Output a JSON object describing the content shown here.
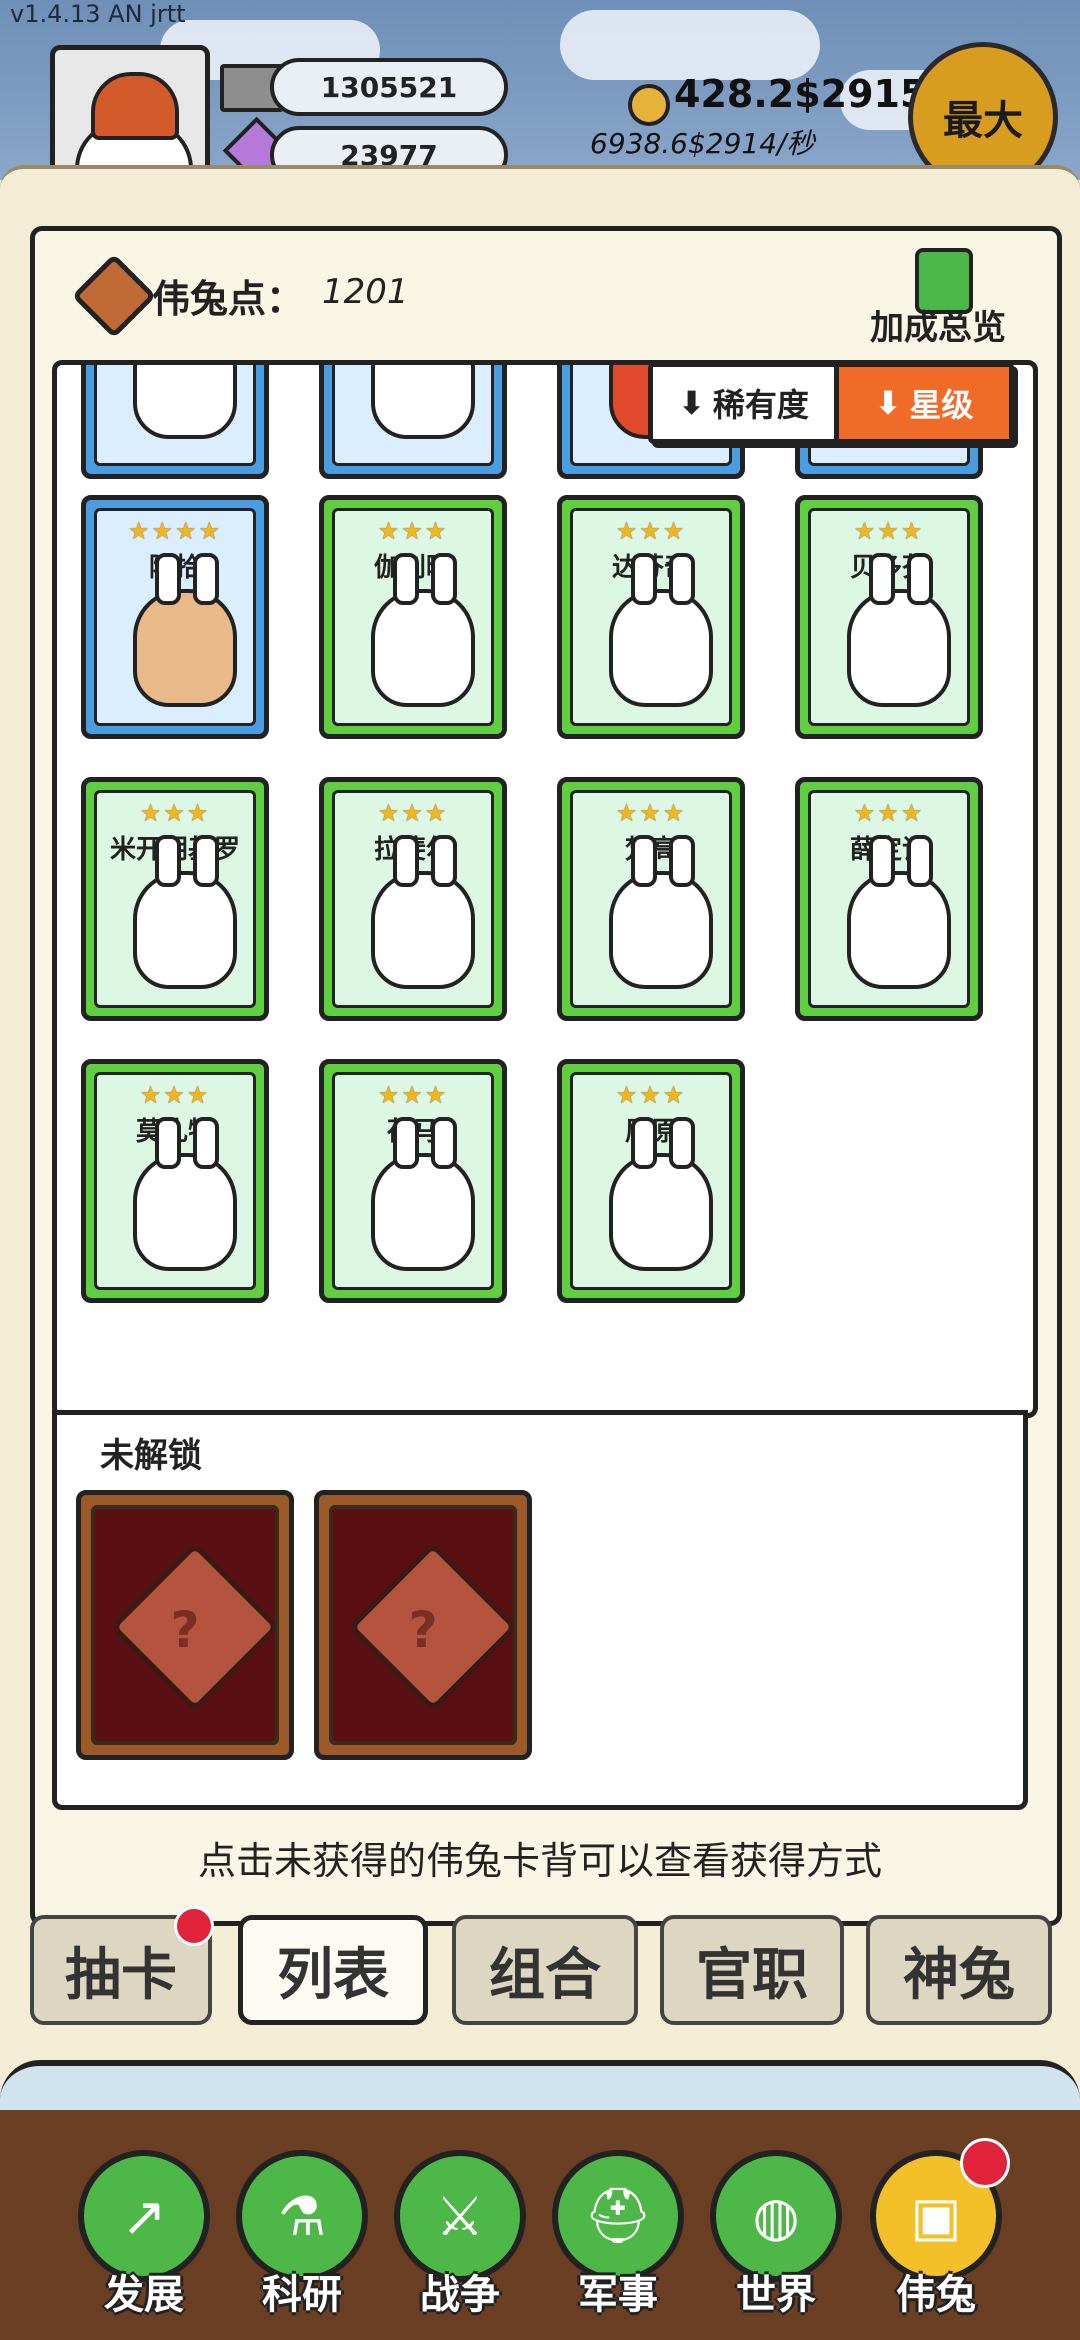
{
  "version": "v1.4.13 AN jrtt",
  "header": {
    "resource_1": "1305521",
    "resource_2": "23977",
    "coin_total": "428.2$2915",
    "coin_rate": "6938.6$2914/秒",
    "max_button": "最大"
  },
  "panel": {
    "points_label": "伟兔点：",
    "points_value": "1201",
    "bonus_overview": "加成总览",
    "sort_rarity": "稀有度",
    "sort_star": "星级",
    "unlock_section": "未解锁",
    "hint": "点击未获得的伟兔卡背可以查看获得方式"
  },
  "cards": [
    {
      "name": "陈拾",
      "stars": "★★★★",
      "color": "blue"
    },
    {
      "name": "伽利略",
      "stars": "★★★",
      "color": "green"
    },
    {
      "name": "达芬奇",
      "stars": "★★★",
      "color": "green"
    },
    {
      "name": "贝多芬",
      "stars": "★★★",
      "color": "green"
    },
    {
      "name": "米开朗基罗",
      "stars": "★★★",
      "color": "green"
    },
    {
      "name": "拉斐尔",
      "stars": "★★★",
      "color": "green"
    },
    {
      "name": "梵高",
      "stars": "★★★",
      "color": "green"
    },
    {
      "name": "薛定谔",
      "stars": "★★★",
      "color": "green"
    },
    {
      "name": "莫扎特",
      "stars": "★★★",
      "color": "green"
    },
    {
      "name": "荷马",
      "stars": "★★★",
      "color": "green"
    },
    {
      "name": "屈原",
      "stars": "★★★",
      "color": "green"
    }
  ],
  "locked_cards": [
    "?",
    "?"
  ],
  "tabs": [
    "抽卡",
    "列表",
    "组合",
    "官职",
    "神兔"
  ],
  "nav": [
    "发展",
    "科研",
    "战争",
    "军事",
    "世界",
    "伟兔"
  ],
  "colors": {
    "accent": "#f06a28",
    "green_card": "#5fcf3f",
    "blue_card": "#4a9de0",
    "nav_green": "#4db848"
  }
}
